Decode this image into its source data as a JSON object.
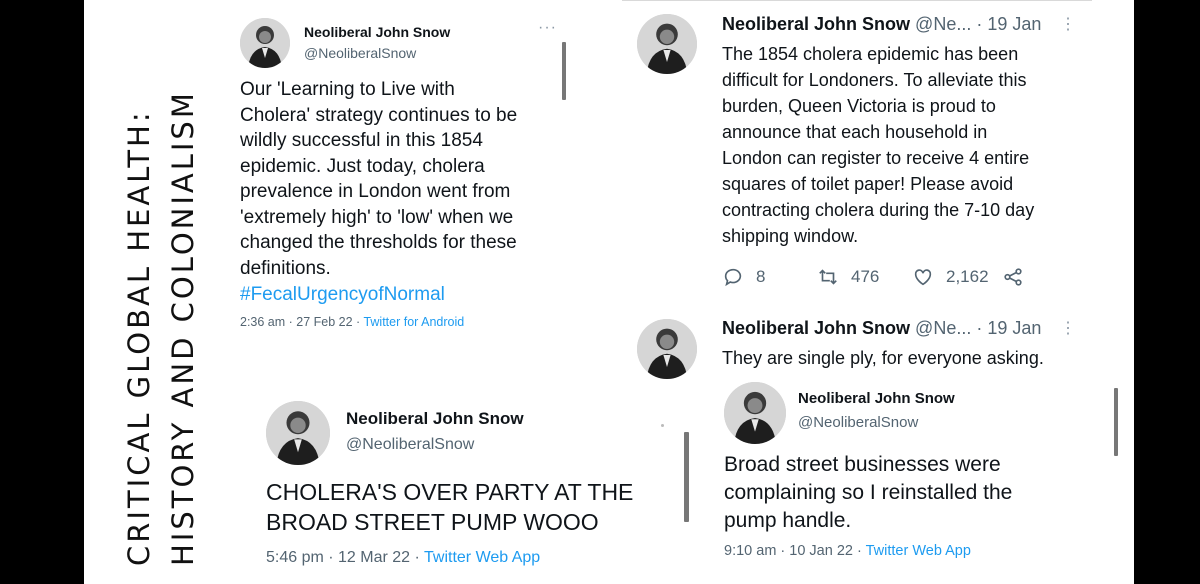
{
  "side_title": {
    "line1": "CRITICAL GLOBAL HEALTH:",
    "line2": "HISTORY AND COLONIALISM"
  },
  "tweet1": {
    "name": "Neoliberal John Snow",
    "handle": "@NeoliberalSnow",
    "text": "Our 'Learning to Live with\nCholera' strategy continues to be\nwildly successful in this 1854\nepidemic. Just today, cholera\nprevalence in London went from\n'extremely high' to 'low' when we\nchanged the thresholds for these\ndefinitions.",
    "hashtag": "#FecalUrgencyofNormal",
    "time": "2:36 am · 27 Feb 22 · ",
    "source": "Twitter for Android"
  },
  "tweet2": {
    "name": "Neoliberal John Snow",
    "handle": "@NeoliberalSnow",
    "text": "CHOLERA'S OVER PARTY AT THE\nBROAD STREET PUMP WOOO",
    "time": "5:46 pm · 12 Mar 22 · ",
    "source": "Twitter Web App"
  },
  "tweet3": {
    "name": "Neoliberal John Snow",
    "handle_date": "@Ne... · 19 Jan",
    "text": "The 1854 cholera epidemic has been\ndifficult for Londoners. To alleviate this\nburden, Queen Victoria is proud to\nannounce that each household in\nLondon can register to receive 4 entire\nsquares of toilet paper! Please avoid\ncontracting cholera during the 7-10 day\nshipping window.",
    "replies": "8",
    "retweets": "476",
    "likes": "2,162"
  },
  "tweet4": {
    "name": "Neoliberal John Snow",
    "handle_date": "@Ne... · 19 Jan",
    "text": "They are single ply, for everyone asking."
  },
  "tweet5": {
    "name": "Neoliberal John Snow",
    "handle": "@NeoliberalSnow",
    "text": "Broad street businesses were\ncomplaining so I reinstalled the\npump handle.",
    "time": "9:10 am · 10 Jan 22 · ",
    "source": "Twitter Web App"
  },
  "colors": {
    "background": "#000000",
    "panel": "#ffffff",
    "link": "#1d9bf0",
    "secondary_text": "#536471"
  },
  "icons": [
    "reply-icon",
    "retweet-icon",
    "like-icon",
    "share-icon",
    "more-icon"
  ]
}
